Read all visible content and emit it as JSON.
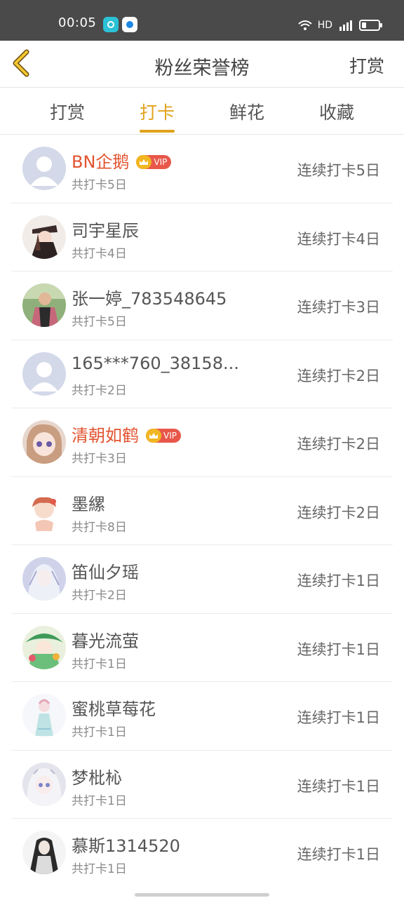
{
  "status_bar": {
    "time": "00:05",
    "network": "HD"
  },
  "header": {
    "title": "粉丝荣誉榜",
    "right_action": "打赏"
  },
  "tabs": [
    {
      "label": "打赏",
      "active": false
    },
    {
      "label": "打卡",
      "active": true
    },
    {
      "label": "鲜花",
      "active": false
    },
    {
      "label": "收藏",
      "active": false
    }
  ],
  "vip_label": "VIP",
  "list": [
    {
      "name": "BN企鹅",
      "vip": true,
      "total": "共打卡5日",
      "streak": "连续打卡5日",
      "avatar": "default-avatar"
    },
    {
      "name": "司宇星辰",
      "vip": false,
      "total": "共打卡4日",
      "streak": "连续打卡4日",
      "avatar": "dark-anime-avatar"
    },
    {
      "name": "张一婷_783548645",
      "vip": false,
      "total": "共打卡5日",
      "streak": "连续打卡3日",
      "avatar": "photo-avatar"
    },
    {
      "name": "165***760_38158...",
      "vip": false,
      "total": "共打卡2日",
      "streak": "连续打卡2日",
      "avatar": "default-avatar"
    },
    {
      "name": "清朝如鹤",
      "vip": true,
      "total": "共打卡3日",
      "streak": "连续打卡2日",
      "avatar": "anime-girl-avatar"
    },
    {
      "name": "墨縲",
      "vip": false,
      "total": "共打卡8日",
      "streak": "连续打卡2日",
      "avatar": "chibi-avatar"
    },
    {
      "name": "笛仙夕瑶",
      "vip": false,
      "total": "共打卡2日",
      "streak": "连续打卡1日",
      "avatar": "silver-anime-avatar"
    },
    {
      "name": "暮光流萤",
      "vip": false,
      "total": "共打卡1日",
      "streak": "连续打卡1日",
      "avatar": "green-anime-avatar"
    },
    {
      "name": "蜜桃草莓花",
      "vip": false,
      "total": "共打卡1日",
      "streak": "连续打卡1日",
      "avatar": "light-anime-avatar"
    },
    {
      "name": "梦枇杺",
      "vip": false,
      "total": "共打卡1日",
      "streak": "连续打卡1日",
      "avatar": "white-hair-avatar"
    },
    {
      "name": "慕斯1314520",
      "vip": false,
      "total": "共打卡1日",
      "streak": "连续打卡1日",
      "avatar": "sketch-avatar"
    }
  ],
  "colors": {
    "accent": "#e0a21d",
    "vip_name": "#e2532f",
    "vip_badge": "#e8574a",
    "crown": "#f1b622"
  }
}
